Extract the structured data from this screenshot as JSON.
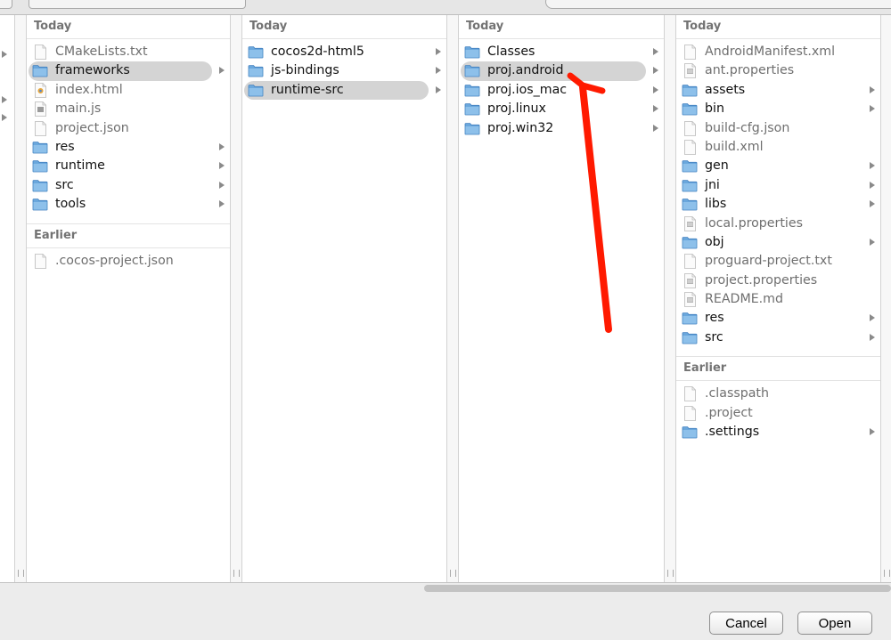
{
  "columns": [
    {
      "groups": [
        {
          "header": "Today",
          "items": [
            {
              "name": "CMakeLists.txt",
              "kind": "file",
              "icon": "text-file-icon"
            },
            {
              "name": "frameworks",
              "kind": "folder",
              "icon": "folder-icon",
              "selected": true
            },
            {
              "name": "index.html",
              "kind": "file",
              "icon": "html-file-icon"
            },
            {
              "name": "main.js",
              "kind": "file",
              "icon": "js-file-icon"
            },
            {
              "name": "project.json",
              "kind": "file",
              "icon": "text-file-icon"
            },
            {
              "name": "res",
              "kind": "folder",
              "icon": "folder-icon"
            },
            {
              "name": "runtime",
              "kind": "folder",
              "icon": "folder-icon"
            },
            {
              "name": "src",
              "kind": "folder",
              "icon": "folder-icon"
            },
            {
              "name": "tools",
              "kind": "folder",
              "icon": "folder-icon"
            }
          ]
        },
        {
          "header": "Earlier",
          "items": [
            {
              "name": ".cocos-project.json",
              "kind": "file",
              "icon": "text-file-icon"
            }
          ]
        }
      ]
    },
    {
      "groups": [
        {
          "header": "Today",
          "items": [
            {
              "name": "cocos2d-html5",
              "kind": "folder",
              "icon": "folder-icon"
            },
            {
              "name": "js-bindings",
              "kind": "folder",
              "icon": "folder-icon"
            },
            {
              "name": "runtime-src",
              "kind": "folder",
              "icon": "folder-icon",
              "selected": true
            }
          ]
        }
      ]
    },
    {
      "groups": [
        {
          "header": "Today",
          "items": [
            {
              "name": "Classes",
              "kind": "folder",
              "icon": "folder-icon"
            },
            {
              "name": "proj.android",
              "kind": "folder",
              "icon": "folder-icon",
              "selected": true
            },
            {
              "name": "proj.ios_mac",
              "kind": "folder",
              "icon": "folder-icon"
            },
            {
              "name": "proj.linux",
              "kind": "folder",
              "icon": "folder-icon"
            },
            {
              "name": "proj.win32",
              "kind": "folder",
              "icon": "folder-icon"
            }
          ]
        }
      ]
    },
    {
      "groups": [
        {
          "header": "Today",
          "items": [
            {
              "name": "AndroidManifest.xml",
              "kind": "file",
              "icon": "text-file-icon"
            },
            {
              "name": "ant.properties",
              "kind": "file",
              "icon": "properties-file-icon"
            },
            {
              "name": "assets",
              "kind": "folder",
              "icon": "folder-icon"
            },
            {
              "name": "bin",
              "kind": "folder",
              "icon": "folder-icon"
            },
            {
              "name": "build-cfg.json",
              "kind": "file",
              "icon": "text-file-icon"
            },
            {
              "name": "build.xml",
              "kind": "file",
              "icon": "text-file-icon"
            },
            {
              "name": "gen",
              "kind": "folder",
              "icon": "folder-icon"
            },
            {
              "name": "jni",
              "kind": "folder",
              "icon": "folder-icon"
            },
            {
              "name": "libs",
              "kind": "folder",
              "icon": "folder-icon"
            },
            {
              "name": "local.properties",
              "kind": "file",
              "icon": "properties-file-icon"
            },
            {
              "name": "obj",
              "kind": "folder",
              "icon": "folder-icon"
            },
            {
              "name": "proguard-project.txt",
              "kind": "file",
              "icon": "text-file-icon"
            },
            {
              "name": "project.properties",
              "kind": "file",
              "icon": "properties-file-icon"
            },
            {
              "name": "README.md",
              "kind": "file",
              "icon": "properties-file-icon"
            },
            {
              "name": "res",
              "kind": "folder",
              "icon": "folder-icon"
            },
            {
              "name": "src",
              "kind": "folder",
              "icon": "folder-icon"
            }
          ]
        },
        {
          "header": "Earlier",
          "items": [
            {
              "name": ".classpath",
              "kind": "file",
              "icon": "text-file-icon"
            },
            {
              "name": ".project",
              "kind": "file",
              "icon": "text-file-icon"
            },
            {
              "name": ".settings",
              "kind": "folder",
              "icon": "folder-icon"
            }
          ]
        }
      ]
    }
  ],
  "buttons": {
    "cancel": "Cancel",
    "open": "Open"
  },
  "colors": {
    "folder": "#5e9fd6",
    "selection": "#d4d4d4",
    "annotation_arrow": "#ff1a00"
  }
}
